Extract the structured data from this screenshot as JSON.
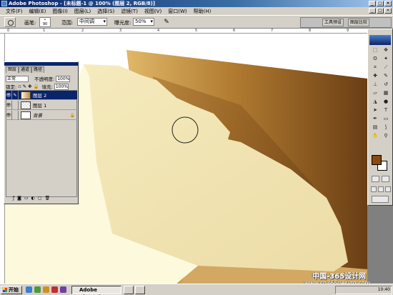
{
  "window": {
    "title": "Adobe Photoshop - [未标题-1 @ 100% (图层 2, RGB/8)]",
    "min": "_",
    "max": "□",
    "close": "×"
  },
  "menu": [
    "文件(F)",
    "编辑(E)",
    "图像(I)",
    "图层(L)",
    "选择(S)",
    "滤镜(T)",
    "视图(V)",
    "窗口(W)",
    "帮助(H)"
  ],
  "options": {
    "brush_label": "画笔:",
    "brush_size": "90",
    "range_label": "范围:",
    "range_value": "中间调",
    "exposure_label": "曝光度:",
    "exposure_value": "50%",
    "tab_tools": "工具预设",
    "tab_comps": "图层比较"
  },
  "ruler": [
    "0",
    "1",
    "2",
    "3",
    "4",
    "5",
    "6",
    "7",
    "8",
    "9"
  ],
  "layers_panel": {
    "tabs": [
      "图层",
      "通道",
      "路径"
    ],
    "blend_mode": "正常",
    "opacity_label": "不透明度:",
    "opacity_value": "100%",
    "lock_label": "锁定:",
    "fill_label": "填充:",
    "fill_value": "100%",
    "layers": [
      {
        "name": "图层 2",
        "active": true
      },
      {
        "name": "图层 1",
        "active": false
      },
      {
        "name": "背景",
        "active": false,
        "locked": true
      }
    ]
  },
  "colors": {
    "foreground": "#8b4a10",
    "background": "#ffffff",
    "cream_light": "#fdf8d8",
    "cream": "#f2e8b8",
    "brown_light": "#c08a40",
    "brown_dark": "#7a4a1a"
  },
  "taskbar": {
    "start": "开始",
    "task_label": "Adobe Photoshop - ...",
    "clock": "10:40"
  },
  "watermark": {
    "line1": "中国-365设计网",
    "line2": "www.cn365design.com"
  }
}
